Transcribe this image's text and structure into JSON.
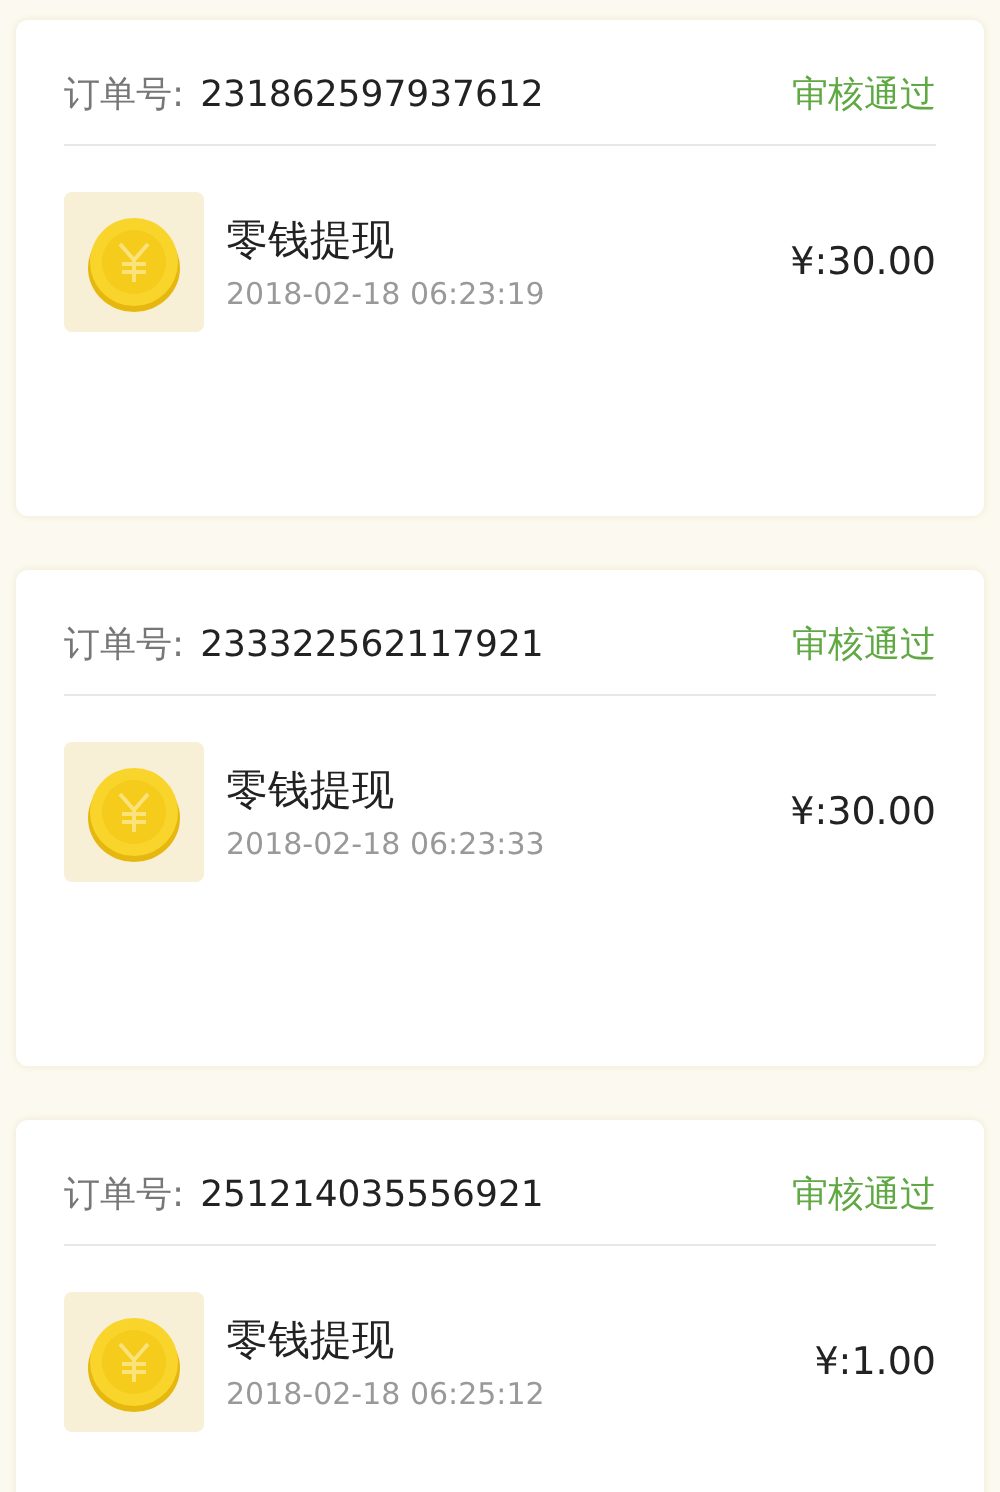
{
  "orders": [
    {
      "order_label": "订单号:",
      "order_number": "231862597937612",
      "status": "审核通过",
      "title": "零钱提现",
      "time": "2018-02-18 06:23:19",
      "amount": "¥:30.00"
    },
    {
      "order_label": "订单号:",
      "order_number": "233322562117921",
      "status": "审核通过",
      "title": "零钱提现",
      "time": "2018-02-18 06:23:33",
      "amount": "¥:30.00"
    },
    {
      "order_label": "订单号:",
      "order_number": "251214035556921",
      "status": "审核通过",
      "title": "零钱提现",
      "time": "2018-02-18 06:25:12",
      "amount": "¥:1.00"
    }
  ]
}
